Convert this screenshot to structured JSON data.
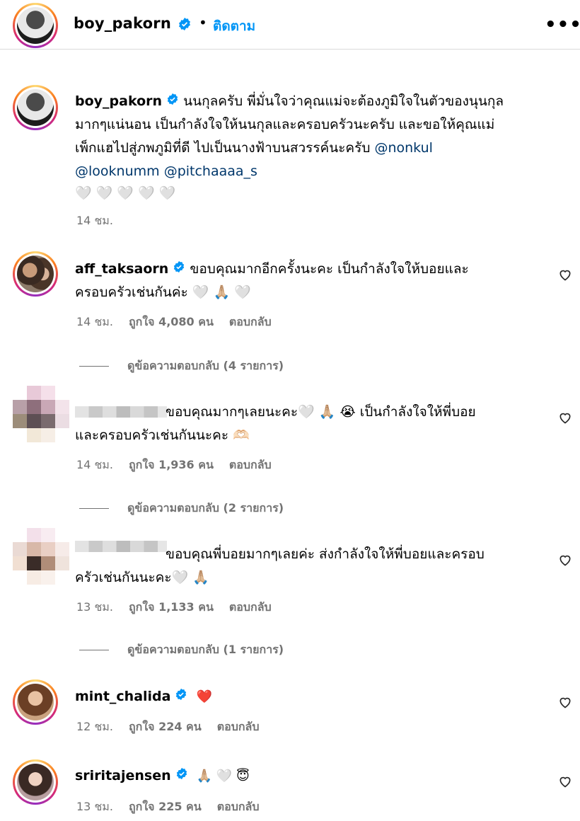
{
  "header": {
    "username": "boy_pakorn",
    "dot": "•",
    "follow_label": "ติดตาม",
    "more_label": "•••"
  },
  "caption": {
    "username": "boy_pakorn",
    "line1": "นนกุลครับ พี่มั่นใจว่าคุณแม่จะต้องภูมิใจในตัวของนุนกุล",
    "line2": "มากๆแน่นอน เป็นกำลังใจให้นนกุลและครอบครัวนะครับ และขอให้คุณแม่",
    "line3": "เพ็กแฮไปสู่ภพภูมิที่ดี ไปเป็นนางฟ้าบนสวรรค์นะครับ",
    "mention1": "@nonkul",
    "mention2": "@looknumm",
    "mention3": "@pitchaaaa_s",
    "emojis": "🤍 🤍 🤍 🤍 🤍",
    "time": "14 ชม."
  },
  "comments": [
    {
      "username": "aff_taksaorn",
      "line1": "ขอบคุณมากอีกครั้งนะคะ เป็นกำลังใจให้บอยและ",
      "line2": "ครอบครัวเช่นกันค่ะ 🤍 🙏🏼 🤍",
      "time": "14 ชม.",
      "likes": "ถูกใจ 4,080 คน",
      "reply": "ตอบกลับ",
      "view_replies": "ดูข้อความตอบกลับ (4 รายการ)"
    },
    {
      "username": "",
      "line1": "ขอบคุณมากๆเลยนะคะ🤍 🙏🏼 😭 เป็นกำลังใจให้พี่บอย",
      "line2": "และครอบครัวเช่นกันนะคะ 🫶🏻",
      "time": "14 ชม.",
      "likes": "ถูกใจ 1,936 คน",
      "reply": "ตอบกลับ",
      "view_replies": "ดูข้อความตอบกลับ (2 รายการ)"
    },
    {
      "username": "",
      "line1": "ขอบคุณพี่บอยมากๆเลยค่ะ ส่งกำลังใจให้พี่บอยและครอบ",
      "line2": "ครัวเช่นกันนะคะ🤍 🙏🏼",
      "time": "13 ชม.",
      "likes": "ถูกใจ 1,133 คน",
      "reply": "ตอบกลับ",
      "view_replies": "ดูข้อความตอบกลับ (1 รายการ)"
    },
    {
      "username": "mint_chalida",
      "line1": "❤️",
      "time": "12 ชม.",
      "likes": "ถูกใจ 224 คน",
      "reply": "ตอบกลับ"
    },
    {
      "username": "sriritajensen",
      "line1": "🙏🏼 🤍 😇",
      "time": "13 ชม.",
      "likes": "ถูกใจ 225 คน",
      "reply": "ตอบกลับ"
    }
  ],
  "colors": {
    "link": "#0095f6",
    "mention": "#00376b",
    "meta": "#737373",
    "verified": "#0095f6"
  },
  "icons": [
    "verified-badge-icon",
    "more-options-icon",
    "heart-outline-icon"
  ]
}
